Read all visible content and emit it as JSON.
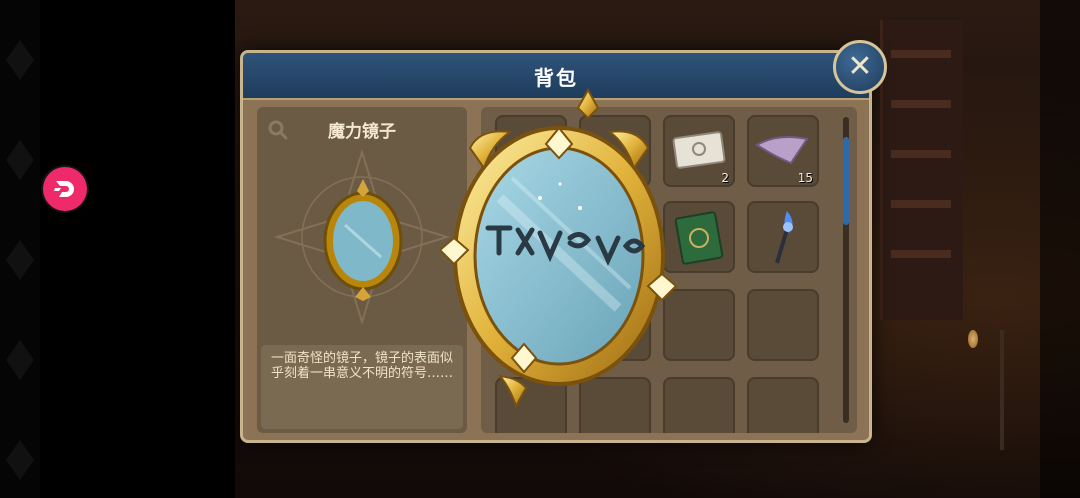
{
  "bag": {
    "title": "背包",
    "selected_item": {
      "name": "魔力镜子",
      "description": "一面奇怪的镜子，镜子的表面似乎刻着一串意义不明的符号……"
    },
    "slots": [
      {
        "icon": "hidden-item-icon",
        "count": ""
      },
      {
        "icon": "hidden-item-icon",
        "count": ""
      },
      {
        "icon": "paper-note-icon",
        "count": "2"
      },
      {
        "icon": "cloth-icon",
        "count": "15"
      },
      {
        "icon": "hidden-item-icon",
        "count": ""
      },
      {
        "icon": "hidden-item-icon",
        "count": ""
      },
      {
        "icon": "green-book-icon",
        "count": ""
      },
      {
        "icon": "blue-torch-icon",
        "count": ""
      },
      {
        "icon": "empty",
        "count": ""
      },
      {
        "icon": "empty",
        "count": ""
      },
      {
        "icon": "empty",
        "count": ""
      },
      {
        "icon": "empty",
        "count": ""
      },
      {
        "icon": "empty",
        "count": ""
      },
      {
        "icon": "empty",
        "count": ""
      },
      {
        "icon": "empty",
        "count": ""
      },
      {
        "icon": "empty",
        "count": ""
      }
    ]
  },
  "colors": {
    "header_blue": "#2e5379",
    "panel_brown": "#8c7355",
    "frame_gold": "#e1b23a",
    "badge_pink": "#ee2a6a"
  }
}
